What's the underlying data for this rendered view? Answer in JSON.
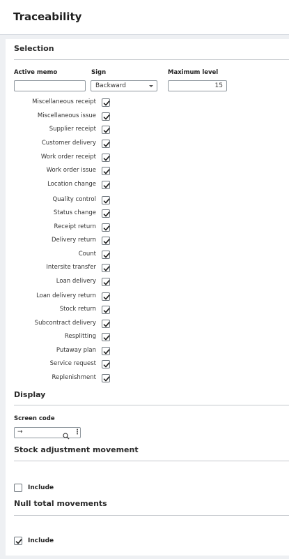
{
  "header": {
    "title": "Traceability"
  },
  "selection": {
    "title": "Selection",
    "active_memo": {
      "label": "Active memo",
      "value": ""
    },
    "sign": {
      "label": "Sign",
      "value": "Backward"
    },
    "maximum_level": {
      "label": "Maximum level",
      "value": "15"
    },
    "checkboxes": [
      {
        "label": "Miscellaneous receipt",
        "checked": true
      },
      {
        "label": "Miscellaneous issue",
        "checked": true
      },
      {
        "label": "Supplier receipt",
        "checked": true
      },
      {
        "label": "Customer delivery",
        "checked": true
      },
      {
        "label": "Work order receipt",
        "checked": true
      },
      {
        "label": "Work order issue",
        "checked": true
      },
      {
        "label": "Location change",
        "checked": true
      },
      {
        "label": "Quality control",
        "checked": true
      },
      {
        "label": "Status change",
        "checked": true
      },
      {
        "label": "Receipt return",
        "checked": true
      },
      {
        "label": "Delivery return",
        "checked": true
      },
      {
        "label": "Count",
        "checked": true
      },
      {
        "label": "Intersite transfer",
        "checked": true
      },
      {
        "label": "Loan delivery",
        "checked": true
      },
      {
        "label": "Loan delivery return",
        "checked": true
      },
      {
        "label": "Stock return",
        "checked": true
      },
      {
        "label": "Subcontract delivery",
        "checked": true
      },
      {
        "label": "Resplitting",
        "checked": true
      },
      {
        "label": "Putaway plan",
        "checked": true
      },
      {
        "label": "Service request",
        "checked": true
      },
      {
        "label": "Replenishment",
        "checked": true
      }
    ]
  },
  "display": {
    "title": "Display",
    "screen_code": {
      "label": "Screen code",
      "arrow": "→",
      "value": ""
    }
  },
  "stock_adjustment": {
    "title": "Stock adjustment movement",
    "include": {
      "label": "Include",
      "checked": false
    }
  },
  "null_total": {
    "title": "Null total movements",
    "include": {
      "label": "Include",
      "checked": true
    }
  },
  "colors": {
    "accent": "#1f1f1f",
    "border": "#8e969d",
    "background": "#eef0f3"
  }
}
